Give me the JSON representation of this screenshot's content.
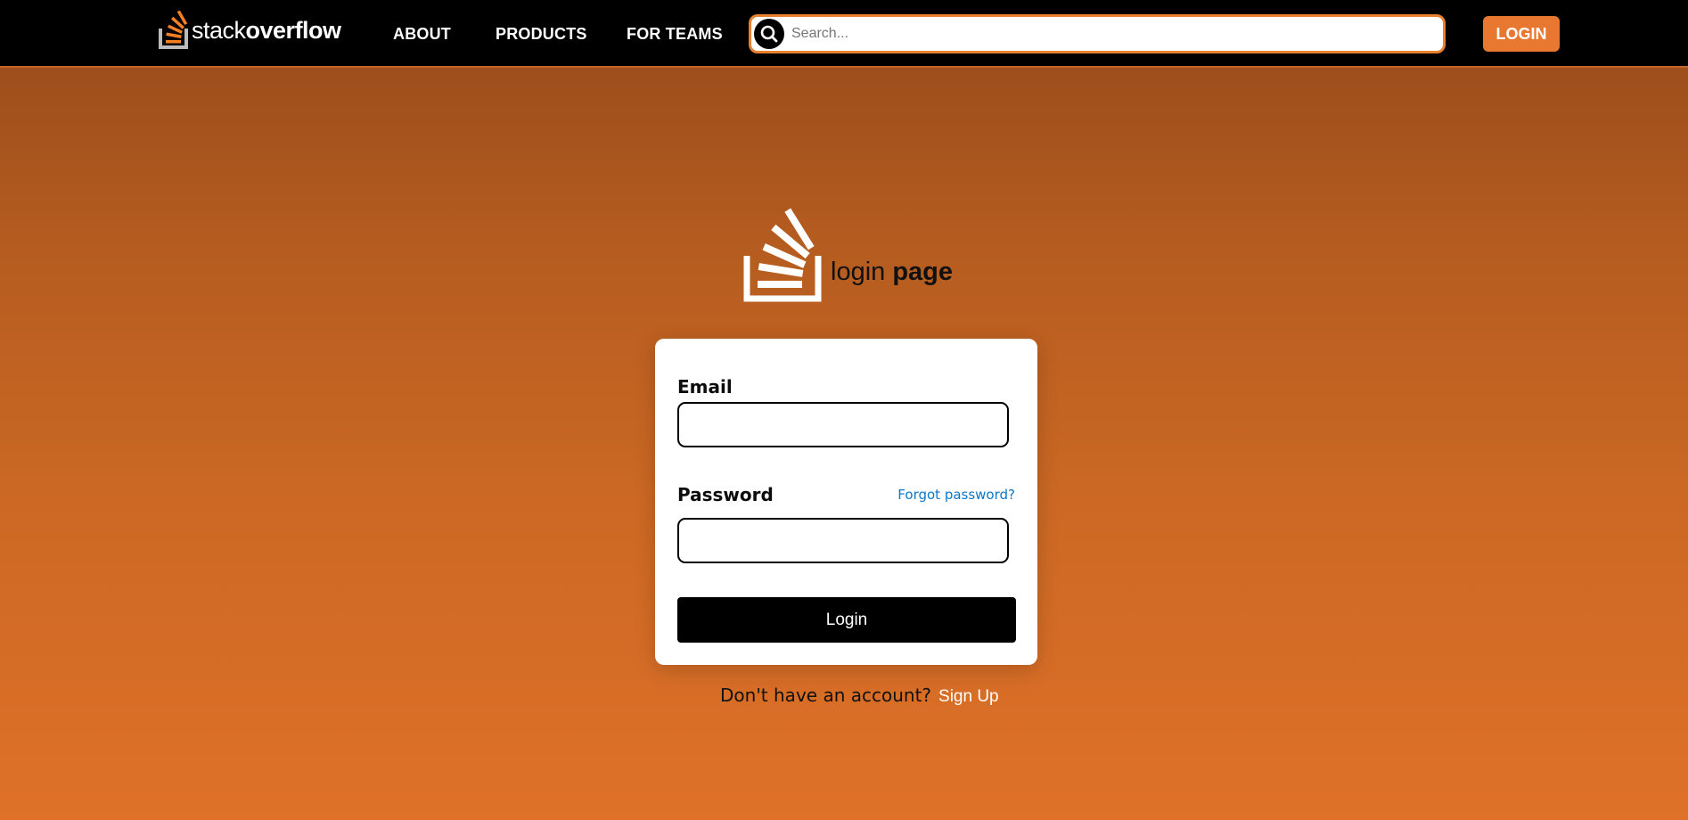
{
  "header": {
    "brand": {
      "thin": "stack",
      "bold": "overflow",
      "icon": "stackoverflow-logo-icon"
    },
    "nav": [
      {
        "label": "ABOUT"
      },
      {
        "label": "PRODUCTS"
      },
      {
        "label": "FOR TEAMS"
      }
    ],
    "search": {
      "placeholder": "Search...",
      "value": "",
      "icon": "search-icon"
    },
    "login_label": "LOGIN"
  },
  "hero": {
    "icon": "stackoverflow-logo-icon",
    "title_thin": "login",
    "title_bold": "page"
  },
  "form": {
    "email_label": "Email",
    "email_value": "",
    "password_label": "Password",
    "password_value": "",
    "forgot_label": "Forgot password?",
    "submit_label": "Login"
  },
  "footer": {
    "prompt": "Don't have an account?",
    "signup_label": "Sign Up"
  },
  "colors": {
    "accent": "#e8782f",
    "header_bg": "#000000",
    "link": "#0a78c9"
  }
}
